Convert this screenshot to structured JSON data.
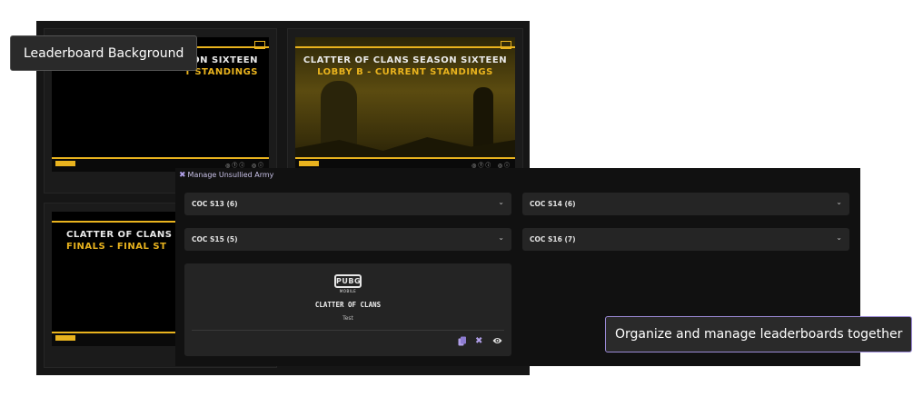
{
  "tooltips": {
    "background": "Leaderboard Background",
    "organize": "Organize and manage leaderboards together"
  },
  "thumbnails": [
    {
      "line1": "ON SIXTEEN",
      "line2": "T STANDINGS"
    },
    {
      "line1": "CLATTER OF CLANS SEASON SIXTEEN",
      "line2": "LOBBY B - CURRENT STANDINGS"
    },
    {
      "line1": "CLATTER OF CLANS SE",
      "line2": "FINALS - FINAL ST"
    }
  ],
  "panel": {
    "title": "Manage Unsullied Army",
    "groups": [
      {
        "label": "COC S13 (6)"
      },
      {
        "label": "COC S14 (6)"
      },
      {
        "label": "COC S15 (5)"
      },
      {
        "label": "COC S16 (7)"
      }
    ],
    "card": {
      "logo_text": "PUBG",
      "logo_sub": "MOBILE",
      "name": "CLATTER OF CLANS",
      "description": "Test"
    }
  },
  "icons": {
    "panel_title": "tools-icon",
    "chevron": "chevron-down-icon",
    "actions": [
      "copy-icon",
      "tools-icon",
      "eye-icon"
    ]
  },
  "colors": {
    "accent_yellow": "#e9b31e",
    "accent_purple": "#b09fe8"
  }
}
